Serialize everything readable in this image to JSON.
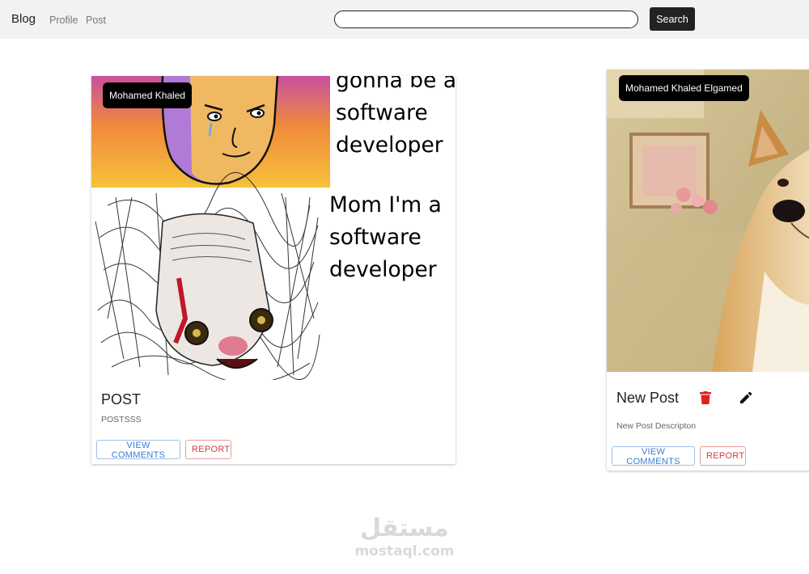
{
  "navbar": {
    "brand": "Blog",
    "links": [
      "Profile",
      "Post"
    ],
    "search_value": "",
    "search_button": "Search"
  },
  "posts": [
    {
      "author": "Mohamed Khaled",
      "meme_text_top": "gonna be a software developer",
      "meme_text_bottom": "Mom I'm a software developer",
      "title": "POST",
      "description": "POSTSSS",
      "view_comments": "VIEW COMMENTS",
      "report": "REPORT"
    },
    {
      "author": "Mohamed Khaled Elgamed",
      "title": "New Post",
      "description": "New Post Descripton",
      "view_comments": "VIEW COMMENTS",
      "report": "REPORT",
      "icons": [
        "delete-icon",
        "edit-icon"
      ]
    }
  ],
  "watermark": {
    "arabic": "مستقل",
    "latin": "mostaql.com"
  },
  "colors": {
    "navbar_bg": "#f2f2f2",
    "search_button_bg": "#222222",
    "chip_bg": "#000000",
    "primary": "#3a7bd5",
    "danger": "#d23a3a",
    "delete_icon": "#e02020"
  }
}
